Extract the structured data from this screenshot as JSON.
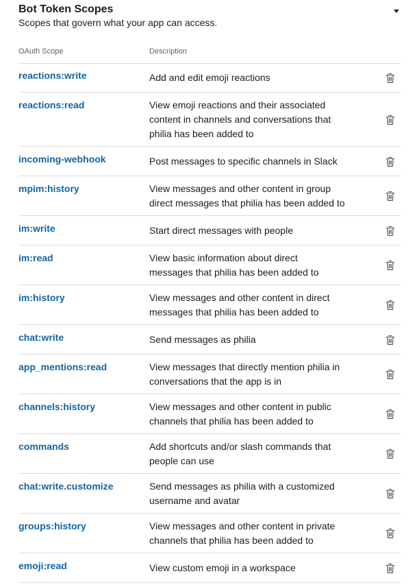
{
  "section": {
    "title": "Bot Token Scopes",
    "subtitle": "Scopes that govern what your app can access.",
    "toggle_icon": "caret-down-icon"
  },
  "columns": {
    "scope": "OAuth Scope",
    "description": "Description"
  },
  "delete_icon": "trash-icon",
  "scopes": [
    {
      "name": "reactions:write",
      "lines": [
        "Add and edit emoji reactions"
      ]
    },
    {
      "name": "reactions:read",
      "lines": [
        "View emoji reactions and their associated",
        "content in channels and conversations that",
        "philia has been added to"
      ]
    },
    {
      "name": "incoming-webhook",
      "lines": [
        "Post messages to specific channels in Slack"
      ]
    },
    {
      "name": "mpim:history",
      "lines": [
        "View messages and other content in group",
        "direct messages that philia has been added to"
      ]
    },
    {
      "name": "im:write",
      "lines": [
        "Start direct messages with people"
      ]
    },
    {
      "name": "im:read",
      "lines": [
        "View basic information about direct",
        "messages that philia has been added to"
      ]
    },
    {
      "name": "im:history",
      "lines": [
        "View messages and other content in direct",
        "messages that philia has been added to"
      ]
    },
    {
      "name": "chat:write",
      "lines": [
        "Send messages as philia"
      ]
    },
    {
      "name": "app_mentions:read",
      "lines": [
        "View messages that directly mention philia in",
        "conversations that the app is in"
      ]
    },
    {
      "name": "channels:history",
      "lines": [
        "View messages and other content in public",
        "channels that philia has been added to"
      ]
    },
    {
      "name": "commands",
      "lines": [
        "Add shortcuts and/or slash commands that",
        "people can use"
      ]
    },
    {
      "name": "chat:write.customize",
      "lines": [
        "Send messages as philia with a customized",
        "username and avatar"
      ]
    },
    {
      "name": "groups:history",
      "lines": [
        "View messages and other content in private",
        "channels that philia has been added to"
      ]
    },
    {
      "name": "emoji:read",
      "lines": [
        "View custom emoji in a workspace"
      ]
    }
  ]
}
